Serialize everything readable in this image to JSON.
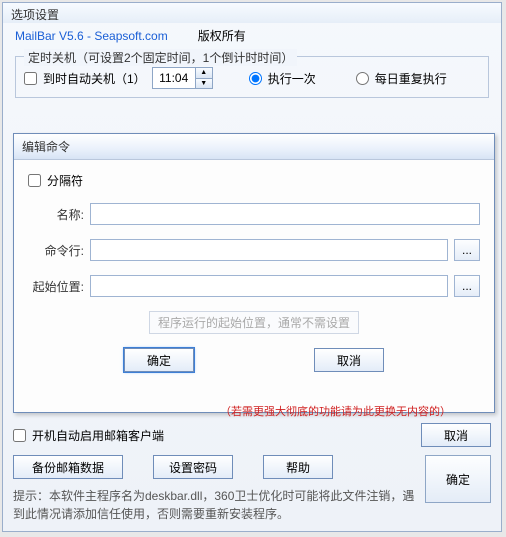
{
  "window": {
    "title": "选项设置",
    "product_link": "MailBar V5.6 - Seapsoft.com",
    "copyright": "版权所有"
  },
  "shutdown": {
    "legend": "定时关机（可设置2个固定时间，1个倒计时时间）",
    "checkbox_label": "到时自动关机（1）",
    "time_value": "11:04",
    "radio_once": "执行一次",
    "radio_daily": "每日重复执行"
  },
  "modal": {
    "title": "编辑命令",
    "delimiter_label": "分隔符",
    "name_label": "名称:",
    "cmd_label": "命令行:",
    "start_label": "起始位置:",
    "browse": "...",
    "hint": "程序运行的起始位置，通常不需设置",
    "ok": "确定",
    "cancel": "取消"
  },
  "bottom": {
    "red_note": "（若需更强大彻底的功能请为此更换无内容的）",
    "auto_start_label": "开机自动启用邮箱客户端",
    "cancel": "取消",
    "backup": "备份邮箱数据",
    "set_password": "设置密码",
    "help": "帮助",
    "confirm": "确定",
    "hint": "提示：本软件主程序名为deskbar.dll，360卫士优化时可能将此文件注销，遇到此情况请添加信任使用，否则需要重新安装程序。"
  }
}
